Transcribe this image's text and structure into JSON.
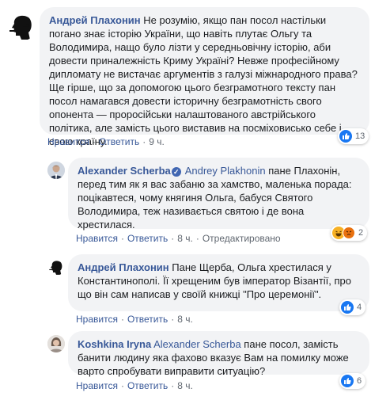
{
  "comments": [
    {
      "author": "Андрей Плахонин",
      "text": " Не розумію, якщо пан посол настільки погано знає історію України, що навіть плутає Ольгу та Володимира, нащо було лізти у середньовічну історію, аби довести приналежність Криму Україні? Невже професійному дипломату не вистачає аргументів з галузі міжнародного права? Ще гірше, що за допомогою цього безграмотного тексту пан посол намагався довести історичну безграмотність свого опонента — проросійськи налаштованого австрійського політика, але замість цього виставив на посміховисько себе і свою країну.",
      "like": "Нравится",
      "reply": "Ответить",
      "time": "9 ч.",
      "reaction_count": "13",
      "reaction_icons": [
        "like-icon"
      ]
    },
    {
      "author": "Alexander Scherba",
      "mention": "Andrey Plakhonin",
      "text": " пане Плахонін, перед тим як я вас забаню за хамство, маленька порада: поцікавтеся, чому княгиня Ольга, бабуся Святого Володимира, теж називається святою і де вона хрестилася.",
      "like": "Нравится",
      "reply": "Ответить",
      "time": "8 ч.",
      "edited": "Отредактировано",
      "reaction_count": "2",
      "reaction_icons": [
        "haha-icon",
        "angry-icon"
      ]
    },
    {
      "author": "Андрей Плахонин",
      "text": " Пане Щерба, Ольга хрестилася у Константинополі. Її хрещеним був імператор Візантії, про що він сам написав у своїй книжці \"Про церемонії\".",
      "like": "Нравится",
      "reply": "Ответить",
      "time": "8 ч.",
      "reaction_count": "4",
      "reaction_icons": [
        "like-icon"
      ]
    },
    {
      "author": "Koshkina Iryna",
      "mention": "Alexander Scherba",
      "text": " пане посол, замість банити людину яка фахово вказує Вам на помилку може варто спробувати виправити ситуацію?",
      "like": "Нравится",
      "reply": "Ответить",
      "time": "8 ч.",
      "reaction_count": "6",
      "reaction_icons": [
        "like-icon"
      ]
    }
  ],
  "colors": {
    "author_link": "#385898",
    "bubble_bg": "#f2f3f5",
    "meta_text": "#606770",
    "like_blue": "#1877f2"
  }
}
